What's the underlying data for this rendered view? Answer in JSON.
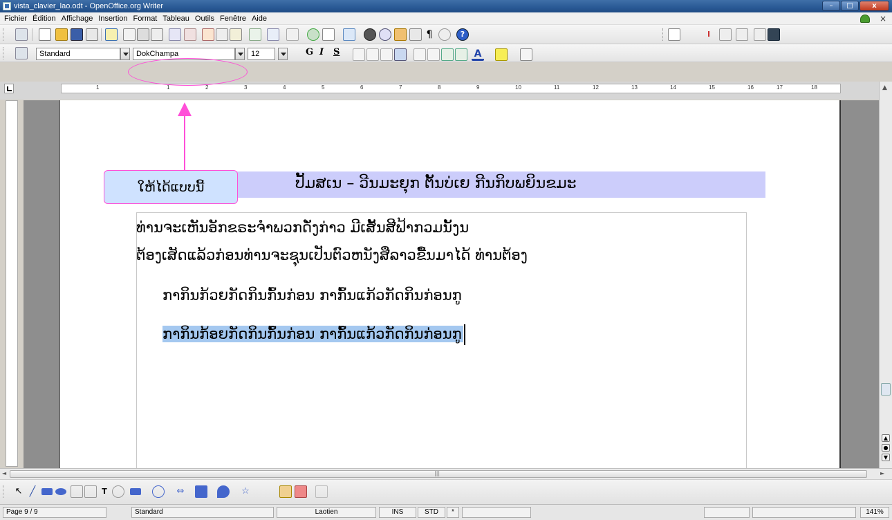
{
  "window": {
    "title": "vista_clavier_lao.odt - OpenOffice.org Writer"
  },
  "menu": [
    "Fichier",
    "Édition",
    "Affichage",
    "Insertion",
    "Format",
    "Tableau",
    "Outils",
    "Fenêtre",
    "Aide"
  ],
  "formatting": {
    "style": "Standard",
    "font": "DokChampa",
    "size": "12",
    "bold": "G",
    "italic": "I",
    "underline": "S"
  },
  "ruler": {
    "numbers": [
      "1",
      "1",
      "2",
      "3",
      "4",
      "5",
      "6",
      "7",
      "8",
      "9",
      "10",
      "11",
      "12",
      "13",
      "14",
      "15",
      "16",
      "17",
      "18"
    ]
  },
  "annotation": {
    "callout_text": "ໃຫ້ໄດ້ແບບນີ້"
  },
  "document": {
    "heading": "ປັ້ມສເນ – ວີນມະຍຸກ ຕັ້ນບ່ເຍ ກີນກິບພຍິນຂມະ",
    "line1": "ທ່ານຈະເຫັນອັກຂຣະຈໍາພວກດັ່ງກ່າວ ມີເສັ້ນສີຟ້າກວມນັ້ງນ",
    "line2": "ຕ້ອງເສັດແລ້ວກ່ອນທ່ານຈະຊຸນເປັນຕົວຫນັງສືລາວຂື້ນມາໄດ້ ທ່ານຕ້ອງ",
    "line3": "ກາກິນກ້ວຍກັດກິນກົ້ນກ່ອນ ກາກົ້ນແກ້ວກັດກິນກ່ອນກູ",
    "line4": "ກາກິນກ້ອຍກັດກິນກົ້ນກ່ອນ ກາກົ້ນແກ້ວກັດກິນກ່ອນກູ"
  },
  "status": {
    "page": "Page 9 / 9",
    "style": "Standard",
    "language": "Laotien",
    "ins": "INS",
    "std": "STD",
    "star": "*",
    "zoom": "141%"
  },
  "colors": {
    "annotation": "#ff4fd8",
    "heading_bg": "#cccdfb",
    "selection": "#a4c8f0"
  }
}
